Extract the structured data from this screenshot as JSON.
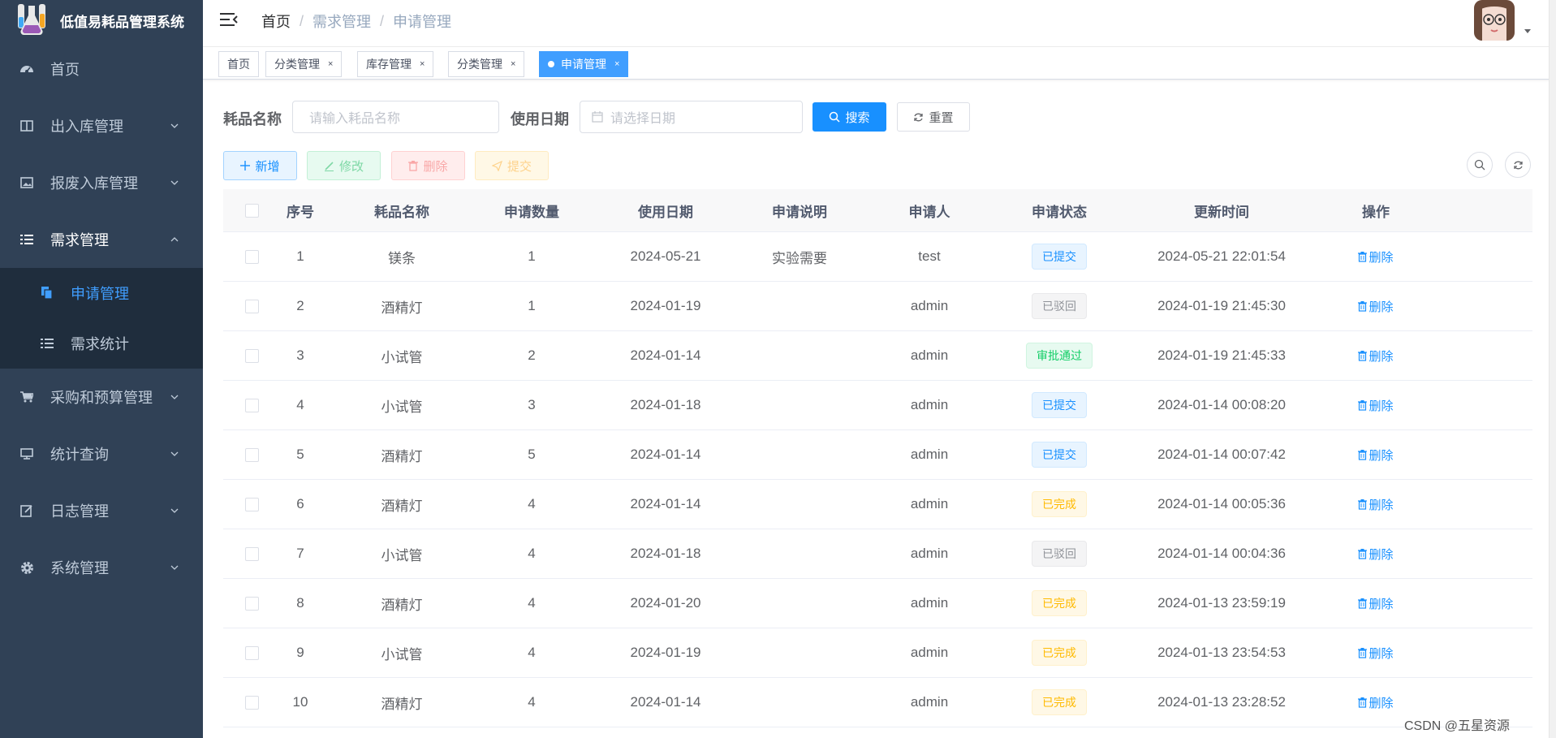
{
  "app": {
    "title": "低值易耗品管理系统"
  },
  "sidebar": {
    "items": [
      {
        "label": "首页",
        "icon": "dashboard-icon"
      },
      {
        "label": "出入库管理",
        "icon": "table-icon"
      },
      {
        "label": "报废入库管理",
        "icon": "image-icon"
      },
      {
        "label": "需求管理",
        "icon": "list-icon",
        "expanded": true
      },
      {
        "label": "采购和预算管理",
        "icon": "cart-icon"
      },
      {
        "label": "统计查询",
        "icon": "monitor-icon"
      },
      {
        "label": "日志管理",
        "icon": "edit-icon"
      },
      {
        "label": "系统管理",
        "icon": "gear-icon"
      }
    ],
    "subitems": [
      {
        "label": "申请管理",
        "icon": "copy-icon",
        "active": true
      },
      {
        "label": "需求统计",
        "icon": "list-icon"
      }
    ]
  },
  "breadcrumb": [
    "首页",
    "需求管理",
    "申请管理"
  ],
  "tags": [
    {
      "label": "首页",
      "closable": false
    },
    {
      "label": "分类管理",
      "closable": true
    },
    {
      "label": "库存管理",
      "closable": true
    },
    {
      "label": "分类管理",
      "closable": true
    },
    {
      "label": "申请管理",
      "closable": true,
      "active": true
    }
  ],
  "tag_close": "×",
  "search": {
    "name_label": "耗品名称",
    "name_placeholder": "请输入耗品名称",
    "date_label": "使用日期",
    "date_placeholder": "请选择日期",
    "search_btn": "搜索",
    "reset_btn": "重置"
  },
  "toolbar": {
    "add": "新增",
    "edit": "修改",
    "delete": "删除",
    "submit": "提交"
  },
  "table": {
    "columns": [
      "序号",
      "耗品名称",
      "申请数量",
      "使用日期",
      "申请说明",
      "申请人",
      "申请状态",
      "更新时间",
      "操作"
    ],
    "rows": [
      {
        "no": "1",
        "name": "镁条",
        "qty": "1",
        "date": "2024-05-21",
        "note": "实验需要",
        "user": "test",
        "status": "已提交",
        "status_color": "blue",
        "updated": "2024-05-21 22:01:54",
        "action": "删除"
      },
      {
        "no": "2",
        "name": "酒精灯",
        "qty": "1",
        "date": "2024-01-19",
        "note": "",
        "user": "admin",
        "status": "已驳回",
        "status_color": "gray",
        "updated": "2024-01-19 21:45:30",
        "action": "删除"
      },
      {
        "no": "3",
        "name": "小试管",
        "qty": "2",
        "date": "2024-01-14",
        "note": "",
        "user": "admin",
        "status": "审批通过",
        "status_color": "green",
        "updated": "2024-01-19 21:45:33",
        "action": "删除"
      },
      {
        "no": "4",
        "name": "小试管",
        "qty": "3",
        "date": "2024-01-18",
        "note": "",
        "user": "admin",
        "status": "已提交",
        "status_color": "blue",
        "updated": "2024-01-14 00:08:20",
        "action": "删除"
      },
      {
        "no": "5",
        "name": "酒精灯",
        "qty": "5",
        "date": "2024-01-14",
        "note": "",
        "user": "admin",
        "status": "已提交",
        "status_color": "blue",
        "updated": "2024-01-14 00:07:42",
        "action": "删除"
      },
      {
        "no": "6",
        "name": "酒精灯",
        "qty": "4",
        "date": "2024-01-14",
        "note": "",
        "user": "admin",
        "status": "已完成",
        "status_color": "yellow",
        "updated": "2024-01-14 00:05:36",
        "action": "删除"
      },
      {
        "no": "7",
        "name": "小试管",
        "qty": "4",
        "date": "2024-01-18",
        "note": "",
        "user": "admin",
        "status": "已驳回",
        "status_color": "gray",
        "updated": "2024-01-14 00:04:36",
        "action": "删除"
      },
      {
        "no": "8",
        "name": "酒精灯",
        "qty": "4",
        "date": "2024-01-20",
        "note": "",
        "user": "admin",
        "status": "已完成",
        "status_color": "yellow",
        "updated": "2024-01-13 23:59:19",
        "action": "删除"
      },
      {
        "no": "9",
        "name": "小试管",
        "qty": "4",
        "date": "2024-01-19",
        "note": "",
        "user": "admin",
        "status": "已完成",
        "status_color": "yellow",
        "updated": "2024-01-13 23:54:53",
        "action": "删除"
      },
      {
        "no": "10",
        "name": "酒精灯",
        "qty": "4",
        "date": "2024-01-14",
        "note": "",
        "user": "admin",
        "status": "已完成",
        "status_color": "yellow",
        "updated": "2024-01-13 23:28:52",
        "action": "删除"
      }
    ]
  },
  "watermark": "CSDN @五星资源",
  "colors": {
    "sidebar_bg": "#304156",
    "submenu_bg": "#1f2d3d",
    "primary": "#1890ff"
  }
}
